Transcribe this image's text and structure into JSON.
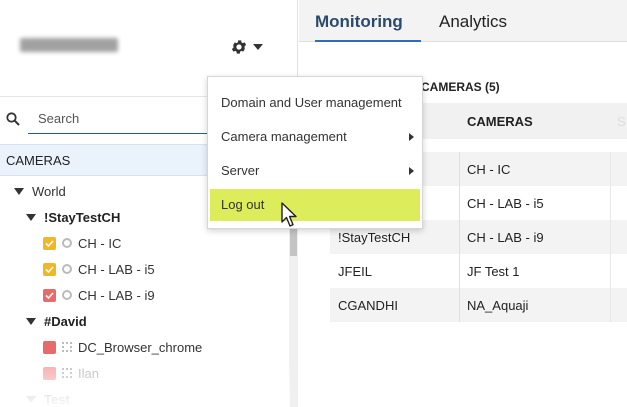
{
  "sidebar": {
    "search_placeholder": "Search",
    "section_title": "CAMERAS",
    "tree": {
      "root": "World",
      "group1": "!StayTestCH",
      "group1_items": [
        "CH - IC",
        "CH - LAB - i5",
        "CH - LAB - i9"
      ],
      "group2": "#David",
      "group2_items": [
        "DC_Browser_chrome",
        "Ilan"
      ],
      "group3": "Test"
    }
  },
  "tabs": [
    "Monitoring",
    "Analytics"
  ],
  "main": {
    "cameras_count_label": "CAMERAS (5)",
    "column_cameras": "CAMERAS",
    "rows": [
      {
        "owner": "",
        "camera": "CH - IC"
      },
      {
        "owner": "",
        "camera": "CH - LAB - i5"
      },
      {
        "owner": "!StayTestCH",
        "camera": "CH - LAB - i9"
      },
      {
        "owner": "JFEIL",
        "camera": "JF Test 1"
      },
      {
        "owner": "CGANDHI",
        "camera": "NA_Aquaji"
      }
    ]
  },
  "menu": {
    "items": [
      "Domain and User management",
      "Camera management",
      "Server",
      "Log out"
    ]
  },
  "colors": {
    "accent": "#2f6db5",
    "highlight": "#dcec5a",
    "check_yellow": "#f0b826",
    "check_red": "#e86a6a"
  }
}
